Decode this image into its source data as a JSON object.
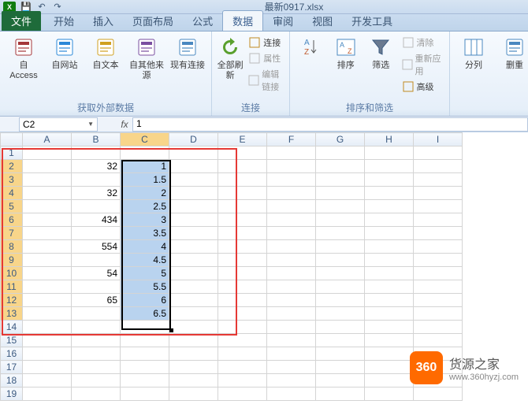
{
  "app": {
    "excel_icon": "X",
    "title": "最新0917.xlsx"
  },
  "qat": {
    "save": "💾",
    "undo": "↶",
    "redo": "↷"
  },
  "tabs": {
    "file": "文件",
    "items": [
      "开始",
      "插入",
      "页面布局",
      "公式",
      "数据",
      "审阅",
      "视图",
      "开发工具"
    ],
    "active_index": 4
  },
  "ribbon": {
    "groups": [
      {
        "label": "获取外部数据",
        "big": [
          {
            "icon": "access",
            "label": "自 Access"
          },
          {
            "icon": "web",
            "label": "自网站"
          },
          {
            "icon": "text",
            "label": "自文本"
          },
          {
            "icon": "other",
            "label": "自其他来源"
          },
          {
            "icon": "existing",
            "label": "现有连接"
          }
        ]
      },
      {
        "label": "连接",
        "big": [
          {
            "icon": "refresh",
            "label": "全部刷新"
          }
        ],
        "small": [
          {
            "icon": "link",
            "label": "连接",
            "disabled": false
          },
          {
            "icon": "props",
            "label": "属性",
            "disabled": true
          },
          {
            "icon": "edit",
            "label": "编辑链接",
            "disabled": true
          }
        ]
      },
      {
        "label": "排序和筛选",
        "big": [
          {
            "icon": "az",
            "label": ""
          },
          {
            "icon": "sort",
            "label": "排序"
          },
          {
            "icon": "filter",
            "label": "筛选"
          }
        ],
        "small": [
          {
            "icon": "clear",
            "label": "清除",
            "disabled": true
          },
          {
            "icon": "reapply",
            "label": "重新应用",
            "disabled": true
          },
          {
            "icon": "adv",
            "label": "高级",
            "disabled": false
          }
        ]
      },
      {
        "label": "",
        "big": [
          {
            "icon": "cols",
            "label": "分列"
          },
          {
            "icon": "dup",
            "label": "删重"
          }
        ]
      }
    ]
  },
  "formula": {
    "name_box": "C2",
    "fx": "fx",
    "value": "1"
  },
  "grid": {
    "columns": [
      "A",
      "B",
      "C",
      "D",
      "E",
      "F",
      "G",
      "H",
      "I"
    ],
    "selected_cols": [
      "C"
    ],
    "rows": 19,
    "selected_rows": [
      2,
      3,
      4,
      5,
      6,
      7,
      8,
      9,
      10,
      11,
      12,
      13
    ],
    "data": {
      "B": {
        "2": "32",
        "4": "32",
        "6": "434",
        "8": "554",
        "10": "54",
        "12": "65"
      },
      "C": {
        "2": "1",
        "3": "1.5",
        "4": "2",
        "5": "2.5",
        "6": "3",
        "7": "3.5",
        "8": "4",
        "9": "4.5",
        "10": "5",
        "11": "5.5",
        "12": "6",
        "13": "6.5"
      }
    }
  },
  "chart_data": {
    "type": "table",
    "title": "Spreadsheet selection C2:C13",
    "columns": [
      "B",
      "C"
    ],
    "rows": [
      {
        "B": 32,
        "C": 1
      },
      {
        "B": null,
        "C": 1.5
      },
      {
        "B": 32,
        "C": 2
      },
      {
        "B": null,
        "C": 2.5
      },
      {
        "B": 434,
        "C": 3
      },
      {
        "B": null,
        "C": 3.5
      },
      {
        "B": 554,
        "C": 4
      },
      {
        "B": null,
        "C": 4.5
      },
      {
        "B": 54,
        "C": 5
      },
      {
        "B": null,
        "C": 5.5
      },
      {
        "B": 65,
        "C": 6
      },
      {
        "B": null,
        "C": 6.5
      }
    ]
  },
  "watermark": {
    "badge": "360",
    "text": "货源之家",
    "sub": "www.360hyzj.com"
  }
}
